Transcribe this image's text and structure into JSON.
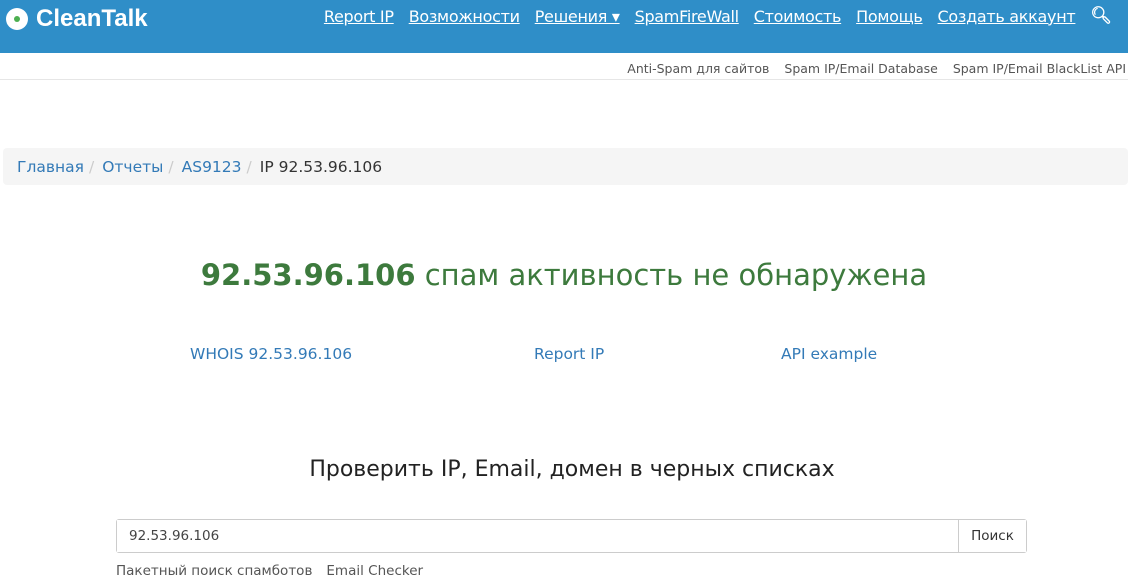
{
  "header": {
    "logo": "CleanTalk",
    "nav": [
      "Report IP",
      "Возможности",
      "Решения ▾",
      "SpamFireWall",
      "Стоимость",
      "Помощь",
      "Создать аккаунт"
    ]
  },
  "subnav": [
    "Anti-Spam для сайтов",
    "Spam IP/Email Database",
    "Spam IP/Email BlackList API"
  ],
  "breadcrumb": [
    "Главная",
    "Отчеты",
    "AS9123"
  ],
  "breadcrumb_current": "IP 92.53.96.106",
  "status": {
    "ip": "92.53.96.106",
    "text": " спам активность не обнаружена",
    "color": "#3d7a3d"
  },
  "links": {
    "whois": "WHOIS 92.53.96.106",
    "report": "Report IP",
    "api": "API example"
  },
  "check": {
    "title": "Проверить IP, Email, домен в черных списках",
    "value": "92.53.96.106",
    "button": "Поиск",
    "bulk": "Пакетный поиск спамботов",
    "email_checker": "Email Checker"
  }
}
